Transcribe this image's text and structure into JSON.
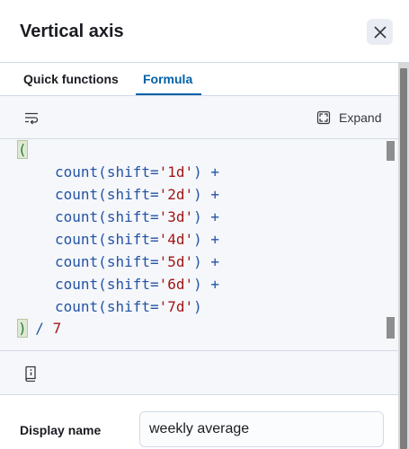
{
  "flyout": {
    "title": "Vertical axis",
    "close_icon": "close-icon"
  },
  "tabs": [
    {
      "label": "Quick functions",
      "selected": false
    },
    {
      "label": "Formula",
      "selected": true
    }
  ],
  "editor": {
    "wrap_icon": "word-wrap-icon",
    "expand_label": "Expand",
    "expand_icon": "fullscreen-icon",
    "docs_icon": "documentation-book-icon",
    "code": {
      "open_paren": "(",
      "lines": [
        {
          "fn": "count",
          "arg": "shift=",
          "str": "'1d'",
          "op": "+"
        },
        {
          "fn": "count",
          "arg": "shift=",
          "str": "'2d'",
          "op": "+"
        },
        {
          "fn": "count",
          "arg": "shift=",
          "str": "'3d'",
          "op": "+"
        },
        {
          "fn": "count",
          "arg": "shift=",
          "str": "'4d'",
          "op": "+"
        },
        {
          "fn": "count",
          "arg": "shift=",
          "str": "'5d'",
          "op": "+"
        },
        {
          "fn": "count",
          "arg": "shift=",
          "str": "'6d'",
          "op": "+"
        },
        {
          "fn": "count",
          "arg": "shift=",
          "str": "'7d'",
          "op": ""
        }
      ],
      "close_paren": ")",
      "divide_op": "/",
      "divisor": "7"
    }
  },
  "display_name": {
    "label": "Display name",
    "value": "weekly average"
  },
  "colors": {
    "accent": "#0061a6",
    "code_function": "#2453a6",
    "code_string": "#a31515"
  }
}
